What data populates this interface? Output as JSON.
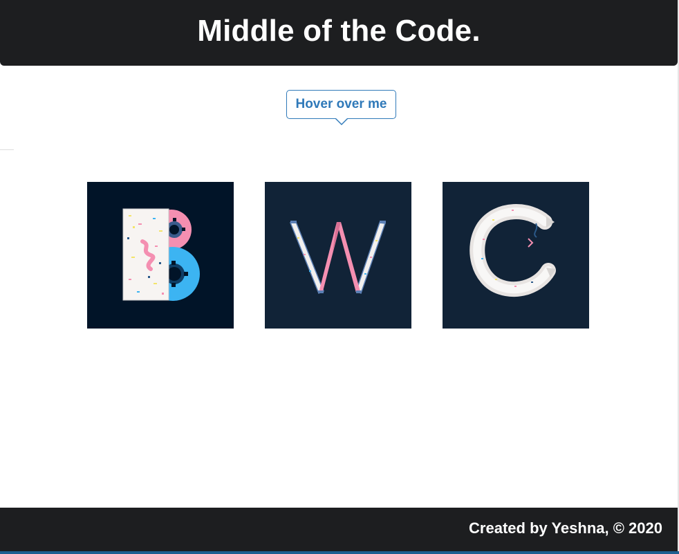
{
  "header": {
    "title": "Middle of the Code."
  },
  "hover_button": {
    "label": "Hover over me"
  },
  "tiles": [
    {
      "letter": "B",
      "icon": "letter-b-icon"
    },
    {
      "letter": "W",
      "icon": "letter-w-icon"
    },
    {
      "letter": "C",
      "icon": "letter-c-icon"
    }
  ],
  "footer": {
    "credit": "Created by Yeshna, © 2020"
  },
  "colors": {
    "header_bg": "#1d1e20",
    "accent": "#2f79b9",
    "tile_bg_dark": "#011428",
    "tile_bg": "#112337"
  }
}
